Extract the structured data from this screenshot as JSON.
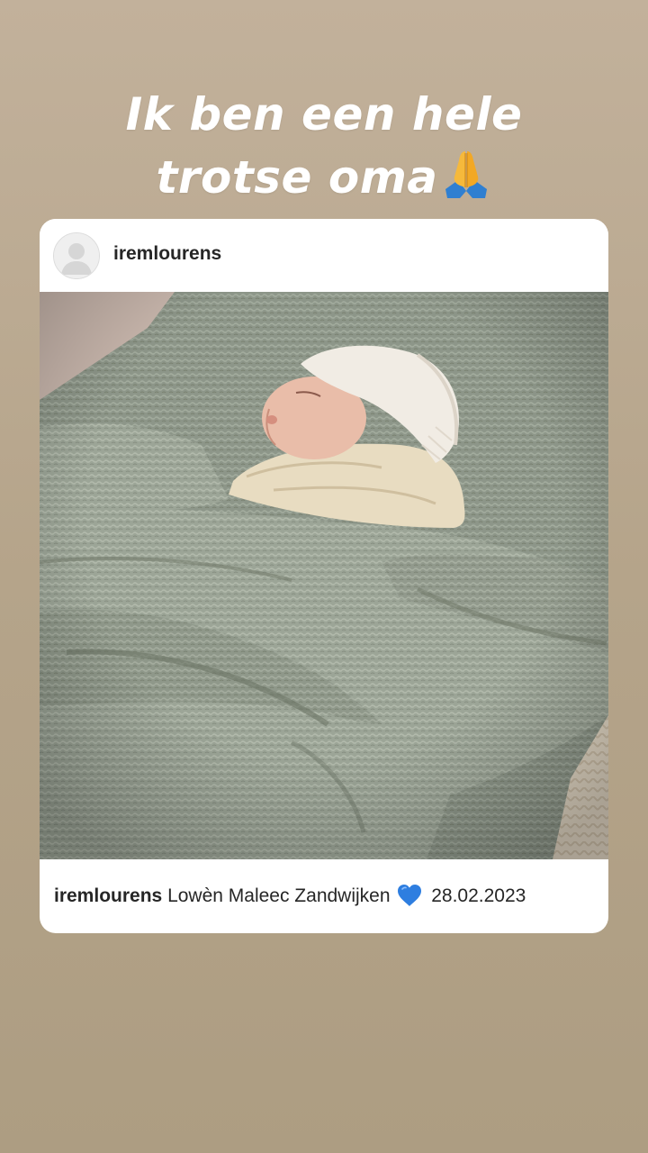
{
  "story": {
    "headline_line1": "Ik ben een hele",
    "headline_line2": "trotse oma",
    "headline_emoji": "folded-hands-icon",
    "background_color": "#b8a68c"
  },
  "post": {
    "username": "iremlourens",
    "caption_user": "iremlourens",
    "caption_text": "Lowèn Maleec Zandwijken",
    "caption_emoji": "blue-heart-icon",
    "caption_date": "28.02.2023",
    "photo_subject": "newborn-photo"
  }
}
